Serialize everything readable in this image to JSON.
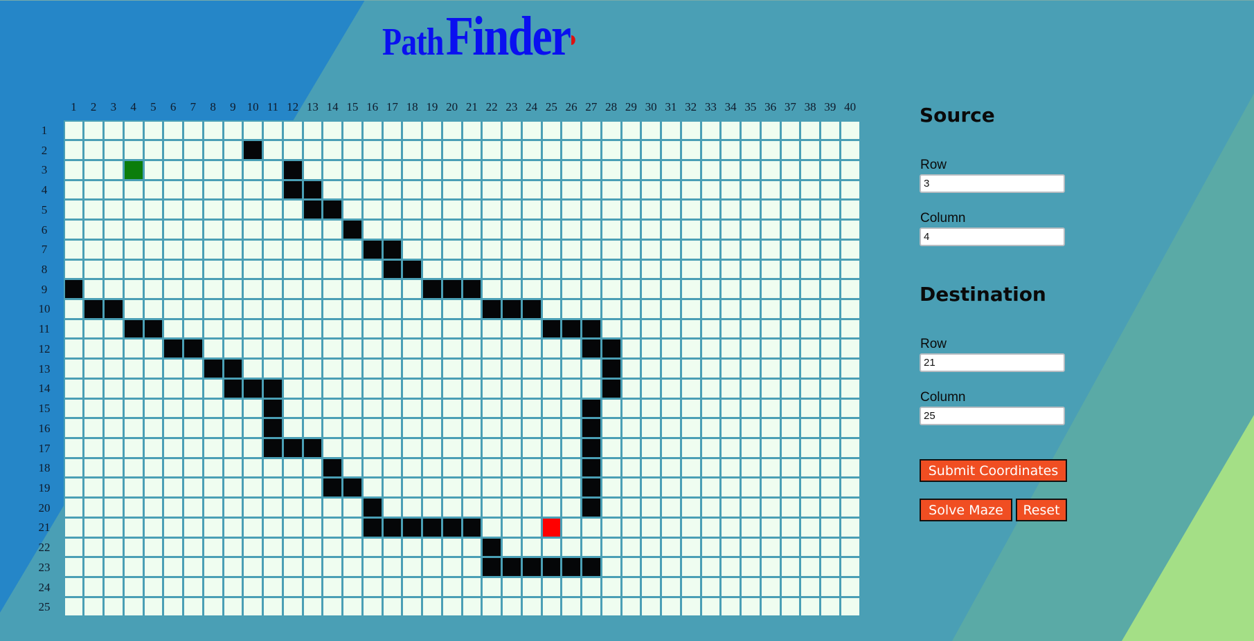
{
  "app": {
    "title_word1": "Path",
    "title_word2": "Finder"
  },
  "colors": {
    "background": "#4a9fb5",
    "cell_empty": "#effdf0",
    "cell_wall": "#050608",
    "cell_source": "#0b7d0b",
    "cell_destination": "#ff0000",
    "title": "#0a10f0",
    "button": "#f04e22"
  },
  "grid": {
    "rows": 25,
    "cols": 40,
    "col_labels": [
      "1",
      "2",
      "3",
      "4",
      "5",
      "6",
      "7",
      "8",
      "9",
      "10",
      "11",
      "12",
      "13",
      "14",
      "15",
      "16",
      "17",
      "18",
      "19",
      "20",
      "21",
      "22",
      "23",
      "24",
      "25",
      "26",
      "27",
      "28",
      "29",
      "30",
      "31",
      "32",
      "33",
      "34",
      "35",
      "36",
      "37",
      "38",
      "39",
      "40"
    ],
    "row_labels": [
      "1",
      "2",
      "3",
      "4",
      "5",
      "6",
      "7",
      "8",
      "9",
      "10",
      "11",
      "12",
      "13",
      "14",
      "15",
      "16",
      "17",
      "18",
      "19",
      "20",
      "21",
      "22",
      "23",
      "24",
      "25"
    ],
    "source": [
      3,
      4
    ],
    "destination": [
      21,
      25
    ],
    "walls": [
      [
        2,
        10
      ],
      [
        3,
        12
      ],
      [
        4,
        12
      ],
      [
        4,
        13
      ],
      [
        5,
        13
      ],
      [
        5,
        14
      ],
      [
        6,
        15
      ],
      [
        7,
        16
      ],
      [
        7,
        17
      ],
      [
        8,
        17
      ],
      [
        8,
        18
      ],
      [
        9,
        1
      ],
      [
        9,
        19
      ],
      [
        9,
        20
      ],
      [
        9,
        21
      ],
      [
        10,
        2
      ],
      [
        10,
        3
      ],
      [
        10,
        22
      ],
      [
        10,
        23
      ],
      [
        10,
        24
      ],
      [
        11,
        4
      ],
      [
        11,
        5
      ],
      [
        11,
        25
      ],
      [
        11,
        26
      ],
      [
        11,
        27
      ],
      [
        12,
        6
      ],
      [
        12,
        7
      ],
      [
        12,
        27
      ],
      [
        12,
        28
      ],
      [
        13,
        8
      ],
      [
        13,
        9
      ],
      [
        13,
        28
      ],
      [
        14,
        9
      ],
      [
        14,
        10
      ],
      [
        14,
        11
      ],
      [
        14,
        28
      ],
      [
        15,
        11
      ],
      [
        15,
        27
      ],
      [
        16,
        11
      ],
      [
        16,
        27
      ],
      [
        17,
        11
      ],
      [
        17,
        12
      ],
      [
        17,
        13
      ],
      [
        17,
        27
      ],
      [
        18,
        14
      ],
      [
        18,
        27
      ],
      [
        19,
        14
      ],
      [
        19,
        15
      ],
      [
        19,
        27
      ],
      [
        20,
        16
      ],
      [
        20,
        27
      ],
      [
        21,
        16
      ],
      [
        21,
        17
      ],
      [
        21,
        18
      ],
      [
        21,
        19
      ],
      [
        21,
        20
      ],
      [
        21,
        21
      ],
      [
        22,
        22
      ],
      [
        23,
        22
      ],
      [
        23,
        23
      ],
      [
        23,
        24
      ],
      [
        23,
        25
      ],
      [
        23,
        26
      ],
      [
        23,
        27
      ]
    ]
  },
  "source": {
    "heading": "Source",
    "row_label": "Row",
    "row_value": "3",
    "col_label": "Column",
    "col_value": "4"
  },
  "destination": {
    "heading": "Destination",
    "row_label": "Row",
    "row_value": "21",
    "col_label": "Column",
    "col_value": "25"
  },
  "buttons": {
    "submit": "Submit Coordinates",
    "solve": "Solve Maze",
    "reset": "Reset"
  }
}
